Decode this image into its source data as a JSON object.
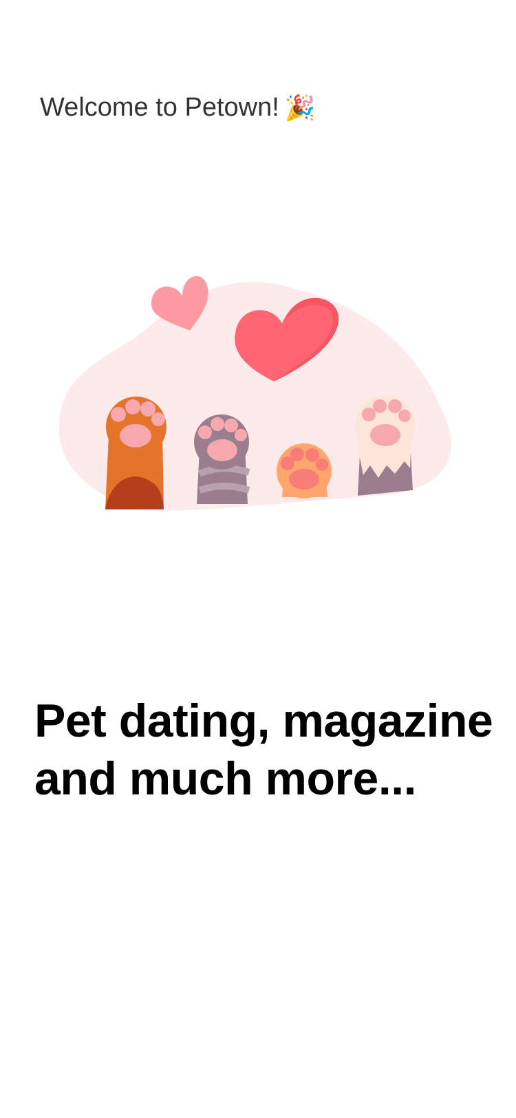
{
  "welcome": {
    "text": "Welcome to Petown!",
    "emoji": "🎉"
  },
  "illustration": {
    "icon": "paws-and-hearts-illustration",
    "colors": {
      "blob": "#FDEBEC",
      "heart_large": "#FF6672",
      "heart_small": "#FF9AA3",
      "paw_pad": "#F7A8AE"
    }
  },
  "headline": {
    "line1": "Pet dating, magazine",
    "line2": "and much more..."
  }
}
